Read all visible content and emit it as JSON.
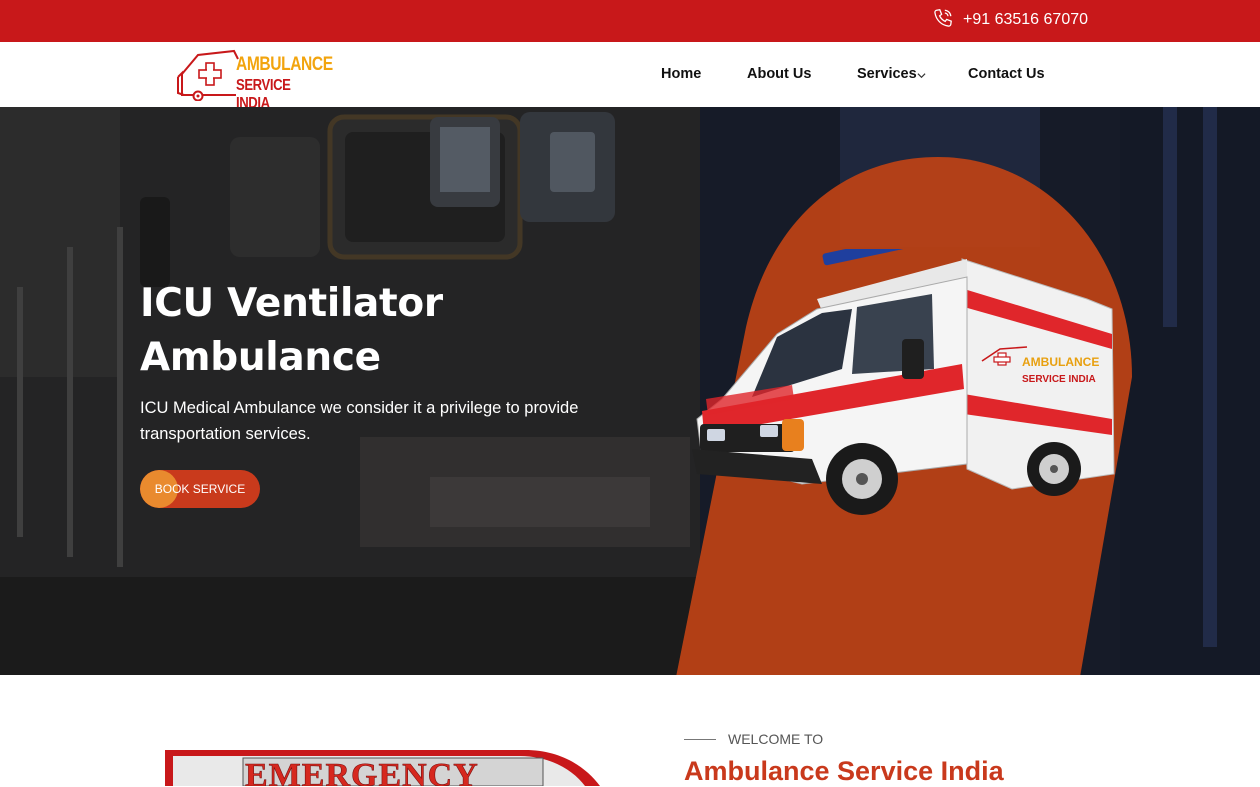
{
  "topbar": {
    "phone": "+91 63516 67070",
    "phone_icon": "phone-icon",
    "color": "#c8181a"
  },
  "logo": {
    "line1": "AMBULANCE",
    "line2": "SERVICE INDIA"
  },
  "nav": {
    "items": [
      {
        "label": "Home"
      },
      {
        "label": "About Us"
      },
      {
        "label": "Services"
      },
      {
        "label": "Contact Us"
      }
    ],
    "services_dropdown_icon": "chevron-down-icon"
  },
  "hero": {
    "title": "ICU Ventilator Ambulance",
    "description": "ICU Medical Ambulance we consider it a privilege to provide transportation services.",
    "button_label": "BOOK SERVICE",
    "accent": "#c93a1c",
    "van_logo_line1": "AMBULANCE",
    "van_logo_line2": "SERVICE INDIA"
  },
  "welcome": {
    "label": "WELCOME TO",
    "title": "Ambulance Service India",
    "image_text": "EMERGENCY"
  }
}
